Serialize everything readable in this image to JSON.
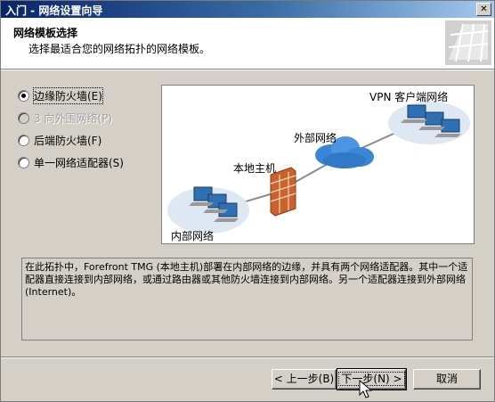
{
  "window": {
    "title": "入门 - 网络设置向导",
    "close_symbol": "✕"
  },
  "header": {
    "title": "网络模板选择",
    "subtitle": "选择最适合您的网络拓扑的网络模板。"
  },
  "options": [
    {
      "label": "边缘防火墙(E)",
      "checked": true,
      "enabled": true
    },
    {
      "label": "3 向外围网络(P)",
      "checked": false,
      "enabled": false
    },
    {
      "label": "后端防火墙(F)",
      "checked": false,
      "enabled": true
    },
    {
      "label": "单一网络适配器(S)",
      "checked": false,
      "enabled": true
    }
  ],
  "diagram": {
    "vpn_label": "VPN 客户端网络",
    "external_label": "外部网络",
    "host_label": "本地主机",
    "internal_label": "内部网络"
  },
  "description": "在此拓扑中，Forefront TMG (本地主机)部署在内部网络的边缘，并具有两个网络适配器。其中一个适配器直接连接到内部网络，或通过路由器或其他防火墙连接到内部网络。另一个适配器连接到外部网络(Internet)。",
  "buttons": {
    "back": "< 上一步(B)",
    "next": "下一步(N) >",
    "cancel": "取消"
  }
}
